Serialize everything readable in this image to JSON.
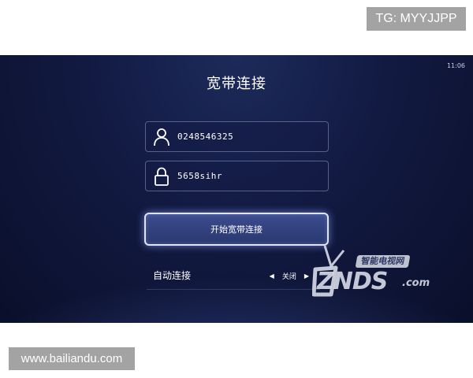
{
  "overlay": {
    "tg_label": "TG: MYYJJPP",
    "footer_label": "www.bailiandu.com"
  },
  "screen": {
    "clock": "11:06",
    "title": "宽带连接",
    "username": {
      "value": "0248546325",
      "icon": "user-icon"
    },
    "password": {
      "value": "5658sihr",
      "icon": "lock-icon"
    },
    "connect_label": "开始宽带连接",
    "auto_connect": {
      "label": "自动连接",
      "value": "关闭",
      "left_arrow": "◀",
      "right_arrow": "▶"
    }
  },
  "watermark": {
    "tag": "智能电视网",
    "main": "ZNDS",
    "suffix": ".com"
  },
  "colors": {
    "screen_bg": "#121a42",
    "button_border": "#dfe4ff",
    "badge_bg": "#a3a3a3"
  }
}
